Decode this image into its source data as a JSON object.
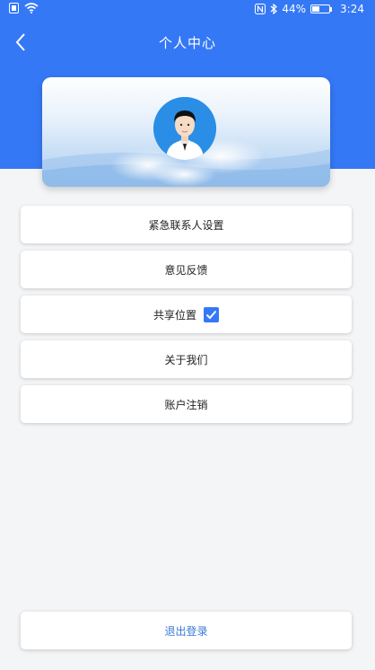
{
  "status_bar": {
    "battery": "44%",
    "time": "3:24",
    "battery_level": 0.44
  },
  "header": {
    "title": "个人中心"
  },
  "menu": {
    "emergency_contact": "紧急联系人设置",
    "feedback": "意见反馈",
    "share_location": "共享位置",
    "share_location_checked": true,
    "about": "关于我们",
    "delete_account": "账户注销"
  },
  "logout": {
    "label": "退出登录"
  },
  "colors": {
    "primary": "#3478f6",
    "logout_text": "#3a78d8"
  }
}
